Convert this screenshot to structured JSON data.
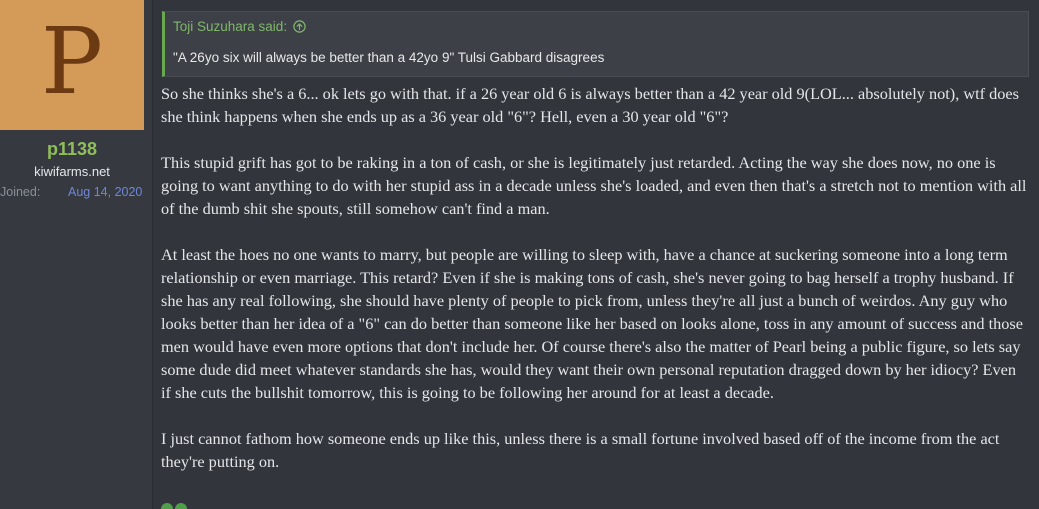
{
  "user": {
    "avatar_letter": "P",
    "name": "p1138",
    "title": "kiwifarms.net",
    "joined_label": "Joined:",
    "joined_date": "Aug 14, 2020"
  },
  "quote": {
    "author_text": "Toji Suzuhara said:",
    "text": "\"A 26yo six will always be better than a 42yo 9\" Tulsi Gabbard disagrees"
  },
  "body": {
    "paragraphs": [
      "So she thinks she's a 6... ok lets go with that. if a 26 year old 6 is always better than a 42 year old 9(LOL... absolutely not), wtf does she think happens when she ends up as a 36 year old \"6\"? Hell, even a 30 year old \"6\"?",
      "This stupid grift has got to be raking in a ton of cash, or she is legitimately just retarded. Acting the way she does now, no one is going to want anything to do with her stupid ass in a decade unless she's loaded, and even then that's a stretch not to mention with all of the dumb shit she spouts, still somehow can't find a man.",
      "At least the hoes no one wants to marry, but people are willing to sleep with, have a chance at suckering someone into a long term relationship or even marriage. This retard? Even if she is making tons of cash, she's never going to bag herself a trophy husband. If she has any real following, she should have plenty of people to pick from, unless they're all just a bunch of weirdos. Any guy who looks better than her idea of a \"6\" can do better than someone like her based on looks alone, toss in any amount of success and those men would have even more options that don't include her. Of course there's also the matter of Pearl being a public figure, so lets say some dude did meet whatever standards she has, would they want their own personal reputation dragged down by her idiocy? Even if she cuts the bullshit tomorrow, this is going to be following her around for at least a decade.",
      "I just cannot fathom how someone ends up like this, unless there is a small fortune involved based off of the income from the act they're putting on."
    ]
  },
  "colors": {
    "avatar_bg": "#d39a58",
    "username": "#8fbf5a",
    "quote_accent": "#6aa84f",
    "link": "#6f86d8"
  },
  "icons": {
    "quote_jump": "arrow-up-circle-icon"
  }
}
